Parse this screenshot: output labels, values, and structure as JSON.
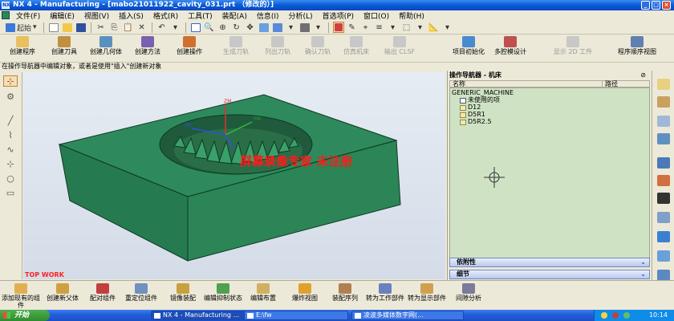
{
  "window": {
    "title": "NX 4 - Manufacturing - [mabo21011922_cavity_031.prt （修改的）]"
  },
  "menu": {
    "items": [
      "文件(F)",
      "编辑(E)",
      "视图(V)",
      "插入(S)",
      "格式(R)",
      "工具(T)",
      "装配(A)",
      "信息(I)",
      "分析(L)",
      "首选项(P)",
      "窗口(O)",
      "帮助(H)"
    ]
  },
  "toolbar1": {
    "start_label": "起始"
  },
  "create_toolbar": {
    "items": [
      {
        "label": "创建程序",
        "enabled": true
      },
      {
        "label": "创建刀具",
        "enabled": true
      },
      {
        "label": "创建几何体",
        "enabled": true
      },
      {
        "label": "创建方法",
        "enabled": true
      },
      {
        "label": "创建操作",
        "enabled": true
      },
      {
        "label": "生成刀轨",
        "enabled": false
      },
      {
        "label": "列出刀轨",
        "enabled": false
      },
      {
        "label": "确认刀轨",
        "enabled": false
      },
      {
        "label": "仿真机床",
        "enabled": false
      },
      {
        "label": "输出 CLSF",
        "enabled": false
      },
      {
        "label": "项目初始化",
        "enabled": true
      },
      {
        "label": "多腔模设计",
        "enabled": true
      },
      {
        "label": "显示 2D 工件",
        "enabled": false
      },
      {
        "label": "程序顺序视图",
        "enabled": true
      }
    ]
  },
  "cue_line": "在操作导航器中编辑对象，或者是使用\"插入\"创建新对象",
  "viewport": {
    "watermark": "屏幕录像专家  未注册",
    "view_label": "TOP WORK",
    "axis_labels": {
      "z": "ZM",
      "y": "YM",
      "x": "XM"
    },
    "part_color": "#2e8a5c",
    "background_color": "#dfe6ef"
  },
  "navigator": {
    "title": "操作导航器 - 机床",
    "columns": {
      "name": "名称",
      "path": "路径"
    },
    "tree": [
      {
        "label": "GENERIC_MACHINE",
        "level": 0,
        "icon": "machine-icon"
      },
      {
        "label": "未使用的项",
        "level": 1,
        "icon": "folder-icon"
      },
      {
        "label": "D12",
        "level": 1,
        "icon": "tool-icon"
      },
      {
        "label": "D5R1",
        "level": 1,
        "icon": "tool-icon"
      },
      {
        "label": "D5R2.5",
        "level": 1,
        "icon": "tool-icon"
      }
    ],
    "dependency_label": "依附性",
    "details_label": "细节"
  },
  "assembly_toolbar": {
    "items": [
      "添加现有的组件",
      "创建新父体",
      "配对组件",
      "重定位组件",
      "镜像装配",
      "编辑抑制状态",
      "编辑布置",
      "爆炸视图",
      "装配序列",
      "转为工作部件",
      "转为显示部件",
      "间隙分析"
    ]
  },
  "taskbar": {
    "start_label": "开始",
    "tasks": [
      "NX 4 - Manufacturing ...",
      "E:\\fw",
      "凌波多媒体数字网(..."
    ],
    "clock": "10:14"
  }
}
